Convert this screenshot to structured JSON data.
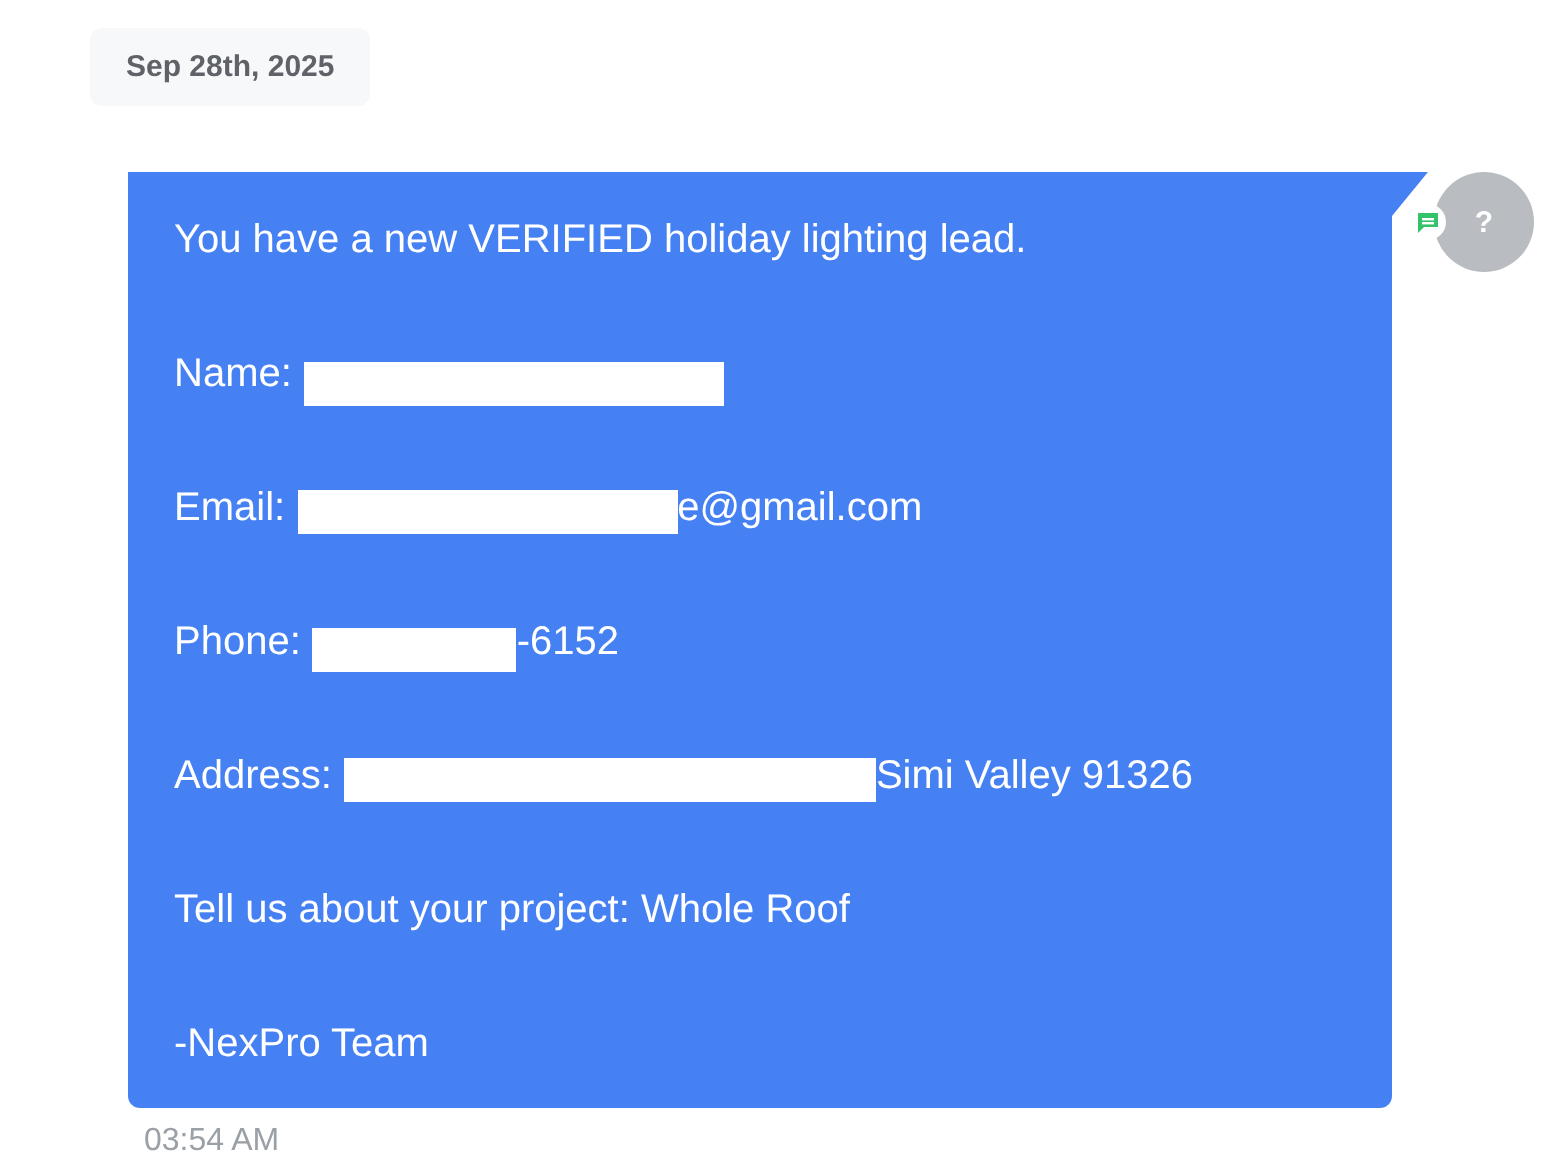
{
  "date_pill": "Sep 28th, 2025",
  "message": {
    "lines": [
      {
        "kind": "text",
        "text": "You have a new VERIFIED holiday lighting lead."
      },
      {
        "kind": "redacted",
        "label": "Name:"
      },
      {
        "kind": "redacted",
        "label": "Email:",
        "suffix": "e@gmail.com"
      },
      {
        "kind": "redacted",
        "label": "Phone:",
        "suffix": "-6152"
      },
      {
        "kind": "redacted",
        "label": "Address:",
        "suffix": "Simi Valley 91326"
      },
      {
        "kind": "text",
        "text": "Tell us about your project: Whole Roof"
      },
      {
        "kind": "text",
        "text": "-NexPro Team"
      }
    ],
    "time": "03:54 AM"
  },
  "avatar": {
    "text": "?"
  }
}
